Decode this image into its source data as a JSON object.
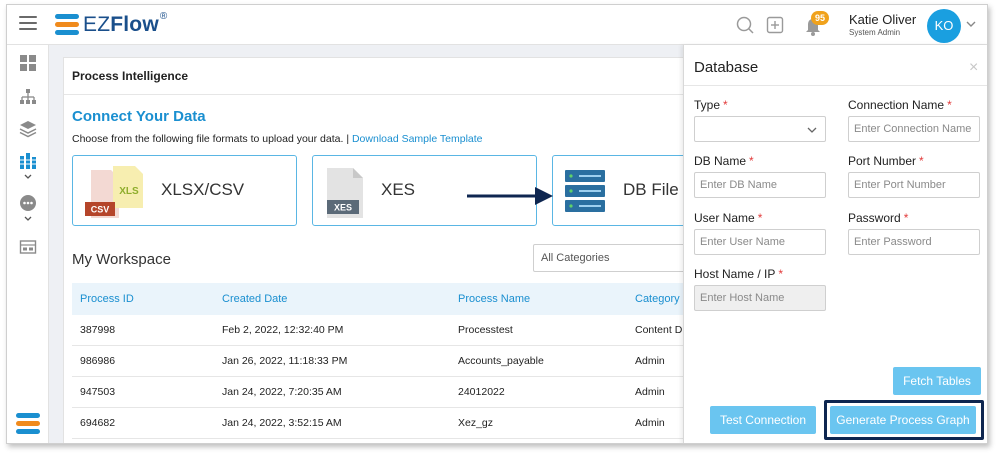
{
  "app": {
    "logo_text_light": "EZ",
    "logo_text_bold": "Flow",
    "logo_reg": "®"
  },
  "header": {
    "notification_count": "95",
    "user_name": "Katie Oliver",
    "user_role": "System Admin",
    "avatar_initials": "KO"
  },
  "sidebar": {
    "items": [
      {
        "icon": "dashboard-icon"
      },
      {
        "icon": "org-chart-icon"
      },
      {
        "icon": "layers-icon"
      },
      {
        "icon": "process-intelligence-icon",
        "active": true
      },
      {
        "icon": "chat-icon"
      },
      {
        "icon": "form-icon"
      }
    ]
  },
  "main": {
    "card_title": "Process Intelligence",
    "connect_title": "Connect Your Data",
    "connect_desc": "Choose from the following file formats to upload your data. |",
    "download_link": "Download Sample Template",
    "formats": [
      {
        "label": "XLSX/CSV",
        "icon": "xlsx-csv-file-icon",
        "badge1": "CSV",
        "badge2": "XLS"
      },
      {
        "label": "XES",
        "icon": "xes-file-icon",
        "badge": "XES"
      },
      {
        "label": "DB File",
        "icon": "database-server-icon"
      }
    ],
    "workspace_title": "My Workspace",
    "category_select": "All Categories",
    "table": {
      "headers": [
        "Process ID",
        "Created Date",
        "Process Name",
        "Category"
      ],
      "rows": [
        [
          "387998",
          "Feb 2, 2022, 12:32:40 PM",
          "Processtest",
          "Content D"
        ],
        [
          "986986",
          "Jan 26, 2022, 11:18:33 PM",
          "Accounts_payable",
          "Admin"
        ],
        [
          "947503",
          "Jan 24, 2022, 7:20:35 AM",
          "24012022",
          "Admin"
        ],
        [
          "694682",
          "Jan 24, 2022, 3:52:15 AM",
          "Xez_gz",
          "Admin"
        ]
      ]
    }
  },
  "panel": {
    "title": "Database",
    "close": "×",
    "fields": {
      "type": {
        "label": "Type",
        "value": ""
      },
      "connection_name": {
        "label": "Connection Name",
        "placeholder": "Enter Connection Name"
      },
      "db_name": {
        "label": "DB Name",
        "placeholder": "Enter DB Name"
      },
      "port_number": {
        "label": "Port Number",
        "placeholder": "Enter Port Number"
      },
      "user_name": {
        "label": "User Name",
        "placeholder": "Enter User Name"
      },
      "password": {
        "label": "Password",
        "placeholder": "Enter Password"
      },
      "host_name": {
        "label": "Host Name / IP",
        "placeholder": "Enter Host Name"
      }
    },
    "required_mark": "*",
    "fetch_tables": "Fetch Tables",
    "test_connection": "Test Connection",
    "generate_graph": "Generate Process Graph"
  },
  "colors": {
    "accent": "#1a8fd0",
    "button": "#6ac5f0",
    "highlight_outline": "#0e2650",
    "arrow": "#0e2650",
    "badge": "#f0a21c"
  }
}
